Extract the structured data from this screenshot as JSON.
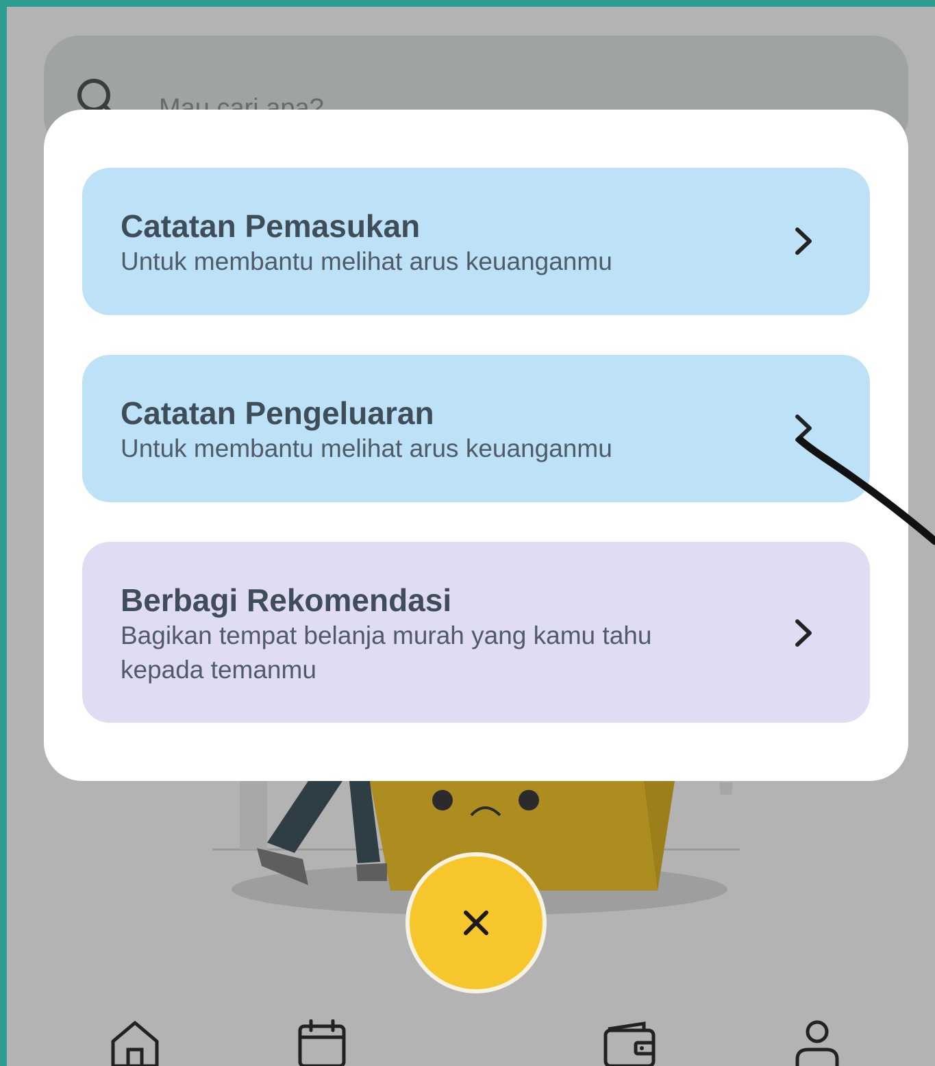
{
  "search": {
    "placeholder": "Mau cari apa?"
  },
  "modal": {
    "cards": [
      {
        "title": "Catatan Pemasukan",
        "subtitle": "Untuk membantu melihat arus keuanganmu",
        "color": "#bde2f7"
      },
      {
        "title": "Catatan Pengeluaran",
        "subtitle": "Untuk membantu melihat arus keuanganmu",
        "color": "#bde2f7"
      },
      {
        "title": "Berbagi Rekomendasi",
        "subtitle": "Bagikan tempat belanja murah yang kamu tahu kepada temanmu",
        "color": "#e0dcf4"
      }
    ]
  },
  "fab": {
    "icon": "close-icon",
    "color": "#f6c62c"
  },
  "bottom_nav": {
    "items": [
      {
        "icon": "home-icon"
      },
      {
        "icon": "calendar-icon"
      },
      {
        "icon": "wallet-icon"
      },
      {
        "icon": "profile-icon"
      }
    ]
  },
  "colors": {
    "accent": "#2e9e90",
    "overlay": "#b3b3b3"
  }
}
